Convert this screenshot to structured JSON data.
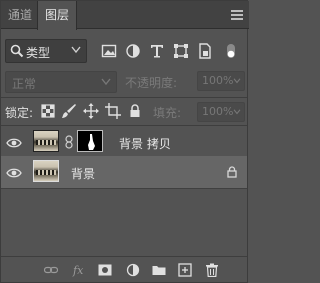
{
  "tabs": [
    {
      "label": "通道"
    },
    {
      "label": "图层"
    }
  ],
  "filter": {
    "kind_label": "类型"
  },
  "blend": {
    "mode": "正常",
    "opacity_label": "不透明度:",
    "opacity_value": "100%"
  },
  "lock": {
    "label": "锁定:",
    "fill_label": "填充:",
    "fill_value": "100%"
  },
  "layers": [
    {
      "name": "背景 拷贝",
      "visible": true,
      "has_mask": true,
      "selected": false
    },
    {
      "name": "背景",
      "visible": true,
      "locked": true,
      "selected": true
    }
  ],
  "colors": {
    "panel_bg": "#535353",
    "tab_bar_bg": "#424242",
    "selected_layer_bg": "#666666"
  }
}
